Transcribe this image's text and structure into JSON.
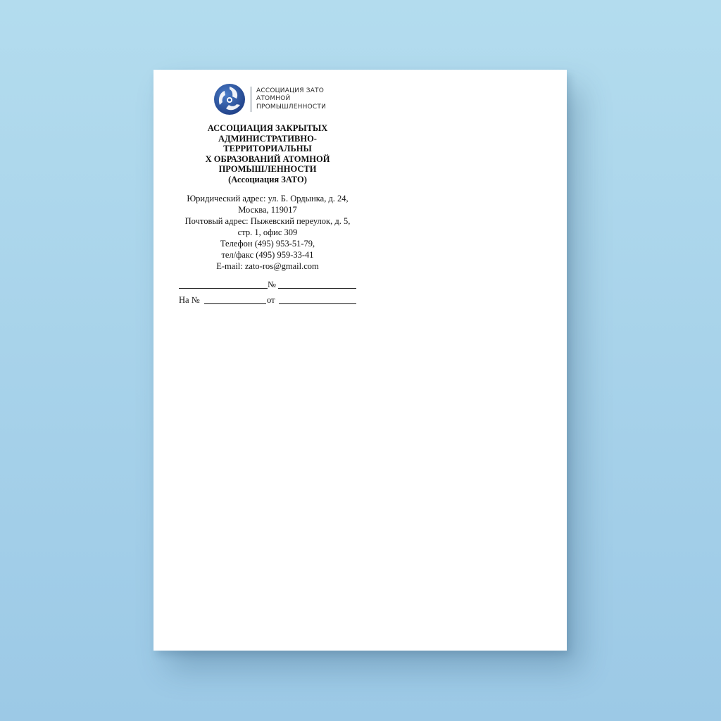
{
  "logo": {
    "text_lines": [
      "АССОЦИАЦИЯ ЗАТО",
      "АТОМНОЙ",
      "ПРОМЫШЛЕННОСТИ"
    ],
    "colors": {
      "primary": "#1f3f86",
      "secondary": "#3c6bb8",
      "accent": "#ffffff"
    }
  },
  "org": {
    "name_lines": [
      "АССОЦИАЦИЯ ЗАКРЫТЫХ",
      "АДМИНИСТРАТИВНО-ТЕРРИТОРИАЛЬНЫ",
      "Х ОБРАЗОВАНИЙ АТОМНОЙ",
      "ПРОМЫШЛЕННОСТИ",
      "(Ассоциация ЗАТО)"
    ]
  },
  "contacts": {
    "lines": [
      "Юридический адрес: ул. Б. Ордынка, д. 24,",
      "Москва, 119017",
      "Почтовый адрес: Пыжевский переулок, д. 5,",
      "стр. 1, офис 309",
      "Телефон (495) 953-51-79,",
      "тел/факс (495) 959-33-41",
      "E-mail: zato-ros@gmail.com"
    ]
  },
  "registration": {
    "number_sign": "№",
    "ref_prefix": "На №",
    "from_label": "от"
  }
}
